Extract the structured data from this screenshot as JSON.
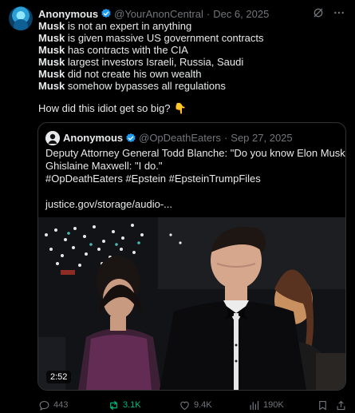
{
  "post": {
    "author_name": "Anonymous",
    "author_handle": "@YourAnonCentral",
    "separator": "·",
    "date": "Dec 6, 2025",
    "lines": [
      {
        "bold": "Musk",
        "rest": " is not an expert in anything"
      },
      {
        "bold": "Musk",
        "rest": " is given massive US government contracts"
      },
      {
        "bold": "Musk",
        "rest": " has contracts with the CIA"
      },
      {
        "bold": "Musk",
        "rest": " largest investors Israeli, Russia, Saudi"
      },
      {
        "bold": "Musk",
        "rest": " did not create his own wealth"
      },
      {
        "bold": "Musk",
        "rest": " somehow bypasses all regulations"
      }
    ],
    "question": "How did this idiot get so big?",
    "question_emoji": "👇"
  },
  "quote": {
    "author_name": "Anonymous",
    "author_handle": "@OpDeathEaters",
    "separator": "·",
    "date": "Sep 27, 2025",
    "lines": [
      "Deputy Attorney General Todd Blanche: \"Do you know Elon Musk?\"",
      "Ghislaine Maxwell: \"I do.\"",
      "#OpDeathEaters #Epstein #EpsteinTrumpFiles",
      "",
      "justice.gov/storage/audio-..."
    ],
    "video_duration": "2:52"
  },
  "actions": {
    "replies": "443",
    "reposts": "3.1K",
    "likes": "9.4K",
    "views": "190K"
  },
  "colors": {
    "background": "#000000",
    "text": "#e7e9ea",
    "muted": "#71767b",
    "verified": "#1d9bf0",
    "repost_active": "#00ba7c",
    "border": "#2f3336"
  },
  "icons": [
    "grok-icon",
    "more-icon",
    "verified-badge-icon",
    "reply-icon",
    "repost-icon",
    "like-icon",
    "views-icon",
    "bookmark-icon",
    "share-icon"
  ]
}
